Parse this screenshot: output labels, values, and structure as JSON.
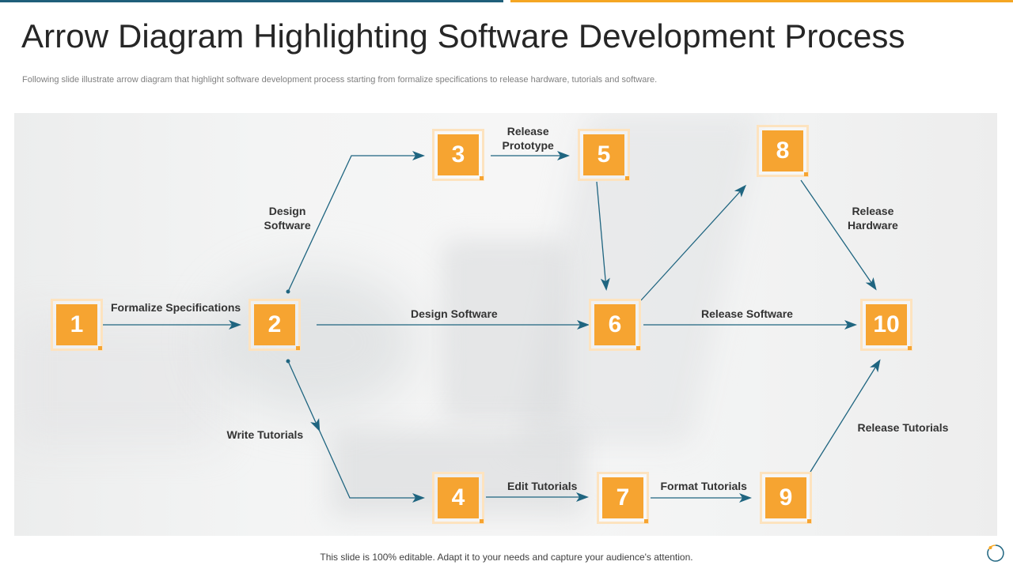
{
  "header": {
    "title": "Arrow Diagram Highlighting Software Development Process",
    "subtitle": "Following slide illustrate arrow diagram that highlight software development process starting from formalize specifications to release hardware, tutorials and software."
  },
  "nodes": [
    {
      "id": "1",
      "label": "1"
    },
    {
      "id": "2",
      "label": "2"
    },
    {
      "id": "3",
      "label": "3"
    },
    {
      "id": "4",
      "label": "4"
    },
    {
      "id": "5",
      "label": "5"
    },
    {
      "id": "6",
      "label": "6"
    },
    {
      "id": "7",
      "label": "7"
    },
    {
      "id": "8",
      "label": "8"
    },
    {
      "id": "9",
      "label": "9"
    },
    {
      "id": "10",
      "label": "10"
    }
  ],
  "edges": [
    {
      "from": "1",
      "to": "2",
      "label": "Formalize Specifications"
    },
    {
      "from": "2",
      "to": "3",
      "label": "Design\nSoftware"
    },
    {
      "from": "2",
      "to": "6",
      "label": "Design Software"
    },
    {
      "from": "2",
      "to": "4",
      "label": "Write Tutorials"
    },
    {
      "from": "3",
      "to": "5",
      "label": "Release\nPrototype"
    },
    {
      "from": "5",
      "to": "6",
      "label": ""
    },
    {
      "from": "6",
      "to": "8",
      "label": ""
    },
    {
      "from": "6",
      "to": "10",
      "label": "Release Software"
    },
    {
      "from": "8",
      "to": "10",
      "label": "Release\nHardware"
    },
    {
      "from": "4",
      "to": "7",
      "label": "Edit Tutorials"
    },
    {
      "from": "7",
      "to": "9",
      "label": "Format Tutorials"
    },
    {
      "from": "9",
      "to": "10",
      "label": "Release Tutorials"
    }
  ],
  "footer": {
    "text": "This slide is 100% editable. Adapt it to your needs and capture your audience's attention."
  },
  "colors": {
    "node_fill": "#f6a431",
    "node_frame": "#fde3bf",
    "connector": "#1f6580",
    "accent_teal": "#1f5f7a",
    "accent_orange": "#f5a623"
  }
}
